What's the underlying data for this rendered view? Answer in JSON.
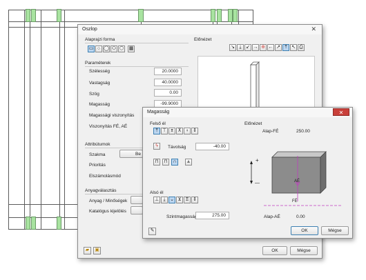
{
  "oszlop": {
    "title": "Oszlop",
    "close_glyph": "✕",
    "section_alaprajzi": "Alaprajzi forma",
    "section_elonezet": "Előnézet",
    "section_parameterek": "Paraméterek",
    "params": {
      "szelesseg_label": "Szélesség",
      "szelesseg_value": "20.0000",
      "vastagsag_label": "Vastagság",
      "vastagsag_value": "40.0000",
      "szog_label": "Szög",
      "szog_value": "0.00",
      "magassag_label": "Magasság",
      "magassag_value": "-99.9000",
      "magassagi_label": "Magassági viszonyítás",
      "viszonyitas_label": "Viszonyítás FÉ, AÉ"
    },
    "section_attributumok": "Attribútumok",
    "attr": {
      "szakma_label": "Szakma",
      "szakma_value": "Be",
      "prioritas_label": "Prioritás",
      "elszamolas_label": "Elszámolásmód"
    },
    "section_anyagvalasztas": "Anyagválasztás",
    "anyag": {
      "anyag_label": "Anyag / Minőségek",
      "katalogus_label": "Katalógus kijelölés"
    },
    "ok_label": "OK",
    "cancel_label": "Mégse"
  },
  "magassag": {
    "title": "Magasság",
    "close_glyph": "✕",
    "felso_el_label": "Felső él",
    "tavolsag_label": "Távolság",
    "tavolsag_value": "-40.00",
    "also_el_label": "Alsó él",
    "szintmagassag_label": "Szintmagasság",
    "szintmagassag_value": "275.00",
    "elonezet_label": "Előnézet",
    "alap_fe_label": "Alap-FÉ",
    "alap_fe_value": "250.00",
    "alap_ae_label": "Alap-AÉ",
    "alap_ae_value": "0.00",
    "ae_marker": "AÉ",
    "fe_marker": "FÉ",
    "plus_sign": "+",
    "minus_sign": "—",
    "ok_label": "OK",
    "cancel_label": "Mégse"
  },
  "colors": {
    "accent": "#3c7fb1",
    "grid_green": "#a8e3a0",
    "block_fill": "#8c8c8c",
    "marker_magenta": "#c03cc0",
    "close_red": "#c9403a"
  }
}
